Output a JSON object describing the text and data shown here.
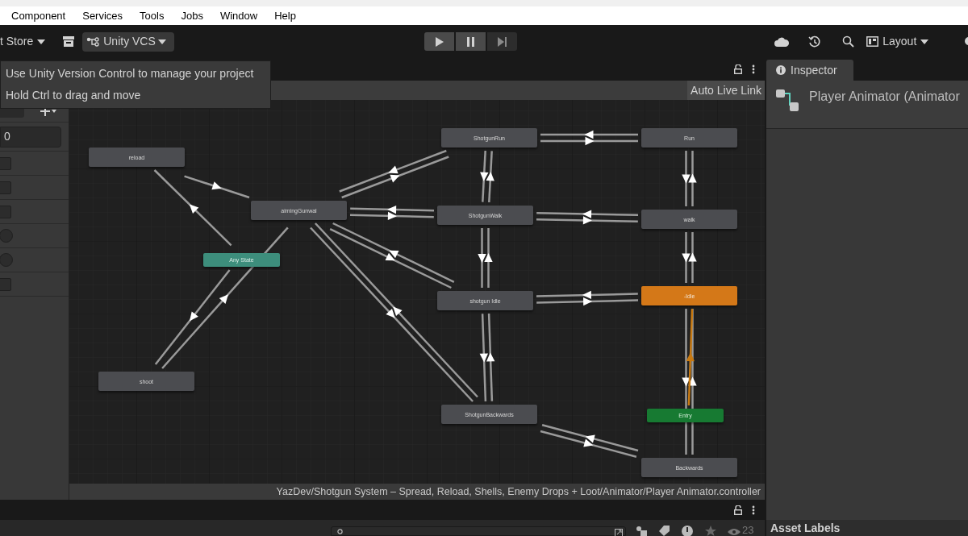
{
  "menu_bar": [
    "Component",
    "Services",
    "Tools",
    "Jobs",
    "Window",
    "Help"
  ],
  "toolbar": {
    "store_label": "t Store",
    "vcs_label": "Unity VCS",
    "layout_label": "Layout"
  },
  "tooltip": [
    "Use Unity Version Control to manage your project",
    "Hold Ctrl to drag and move"
  ],
  "parameters": [
    {
      "kind": "float",
      "value": "0"
    },
    {
      "kind": "bool",
      "checked": false
    },
    {
      "kind": "bool",
      "checked": false
    },
    {
      "kind": "bool",
      "checked": false
    },
    {
      "kind": "trigger",
      "checked": false
    },
    {
      "kind": "trigger",
      "checked": false
    },
    {
      "kind": "bool",
      "checked": false
    }
  ],
  "animator": {
    "live_link": "Auto Live Link",
    "states": [
      {
        "name": "reload",
        "kind": "state"
      },
      {
        "name": "aimingGunwal",
        "kind": "state"
      },
      {
        "name": "Any State",
        "kind": "any"
      },
      {
        "name": "shoot",
        "kind": "state"
      },
      {
        "name": "ShotgunRun",
        "kind": "state"
      },
      {
        "name": "Run",
        "kind": "state"
      },
      {
        "name": "ShotgunWalk",
        "kind": "state"
      },
      {
        "name": "walk",
        "kind": "state"
      },
      {
        "name": "shotgun Idle",
        "kind": "state"
      },
      {
        "name": "-Idle",
        "kind": "default"
      },
      {
        "name": "ShotgunBackwards",
        "kind": "state"
      },
      {
        "name": "Entry",
        "kind": "entry"
      },
      {
        "name": "Backwards",
        "kind": "state"
      }
    ],
    "path": "YazDev/Shotgun System – Spread, Reload, Shells, Enemy Drops + Loot/Animator/Player Animator.controller"
  },
  "inspector": {
    "tab": "Inspector",
    "title": "Player Animator (Animator",
    "footer": "Asset Labels"
  },
  "project": {
    "count": "23"
  }
}
